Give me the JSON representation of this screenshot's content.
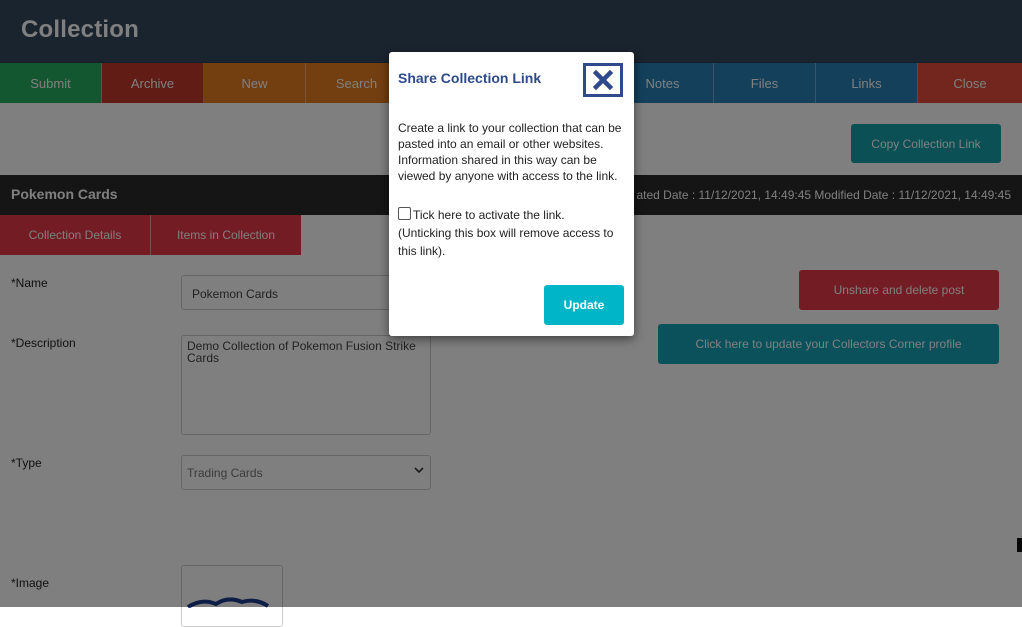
{
  "header": {
    "title": "Collection"
  },
  "toolbar": {
    "submit": "Submit",
    "archive": "Archive",
    "new": "New",
    "search": "Search",
    "notes": "Notes",
    "files": "Files",
    "links": "Links",
    "close": "Close"
  },
  "copy_link_button": "Copy Collection Link",
  "info_bar": {
    "collection_name": "Pokemon Cards",
    "dates": "ated Date : 11/12/2021, 14:49:45 Modified Date : 11/12/2021, 14:49:45"
  },
  "tabs": {
    "details": "Collection Details",
    "items": "Items in Collection"
  },
  "form": {
    "name_label": "*Name",
    "name_value": "Pokemon Cards",
    "description_label": "*Description",
    "description_value": "Demo Collection of Pokemon Fusion Strike Cards",
    "type_label": "*Type",
    "type_value": "Trading Cards",
    "image_label": "*Image"
  },
  "side_buttons": {
    "unshare": "Unshare and delete post",
    "profile": "Click here to update your Collectors Corner profile"
  },
  "modal": {
    "title": "Share Collection Link",
    "body": "Create a link to your collection that can be pasted into an email or other websites. Information shared in this way can be viewed by anyone with access to the link.",
    "checkbox_label": "Tick here to activate the link.",
    "checkbox_note": "(Unticking this box will remove access to this link).",
    "update_button": "Update",
    "accent_color": "#2e4a8b",
    "button_color": "#00b5c8"
  }
}
